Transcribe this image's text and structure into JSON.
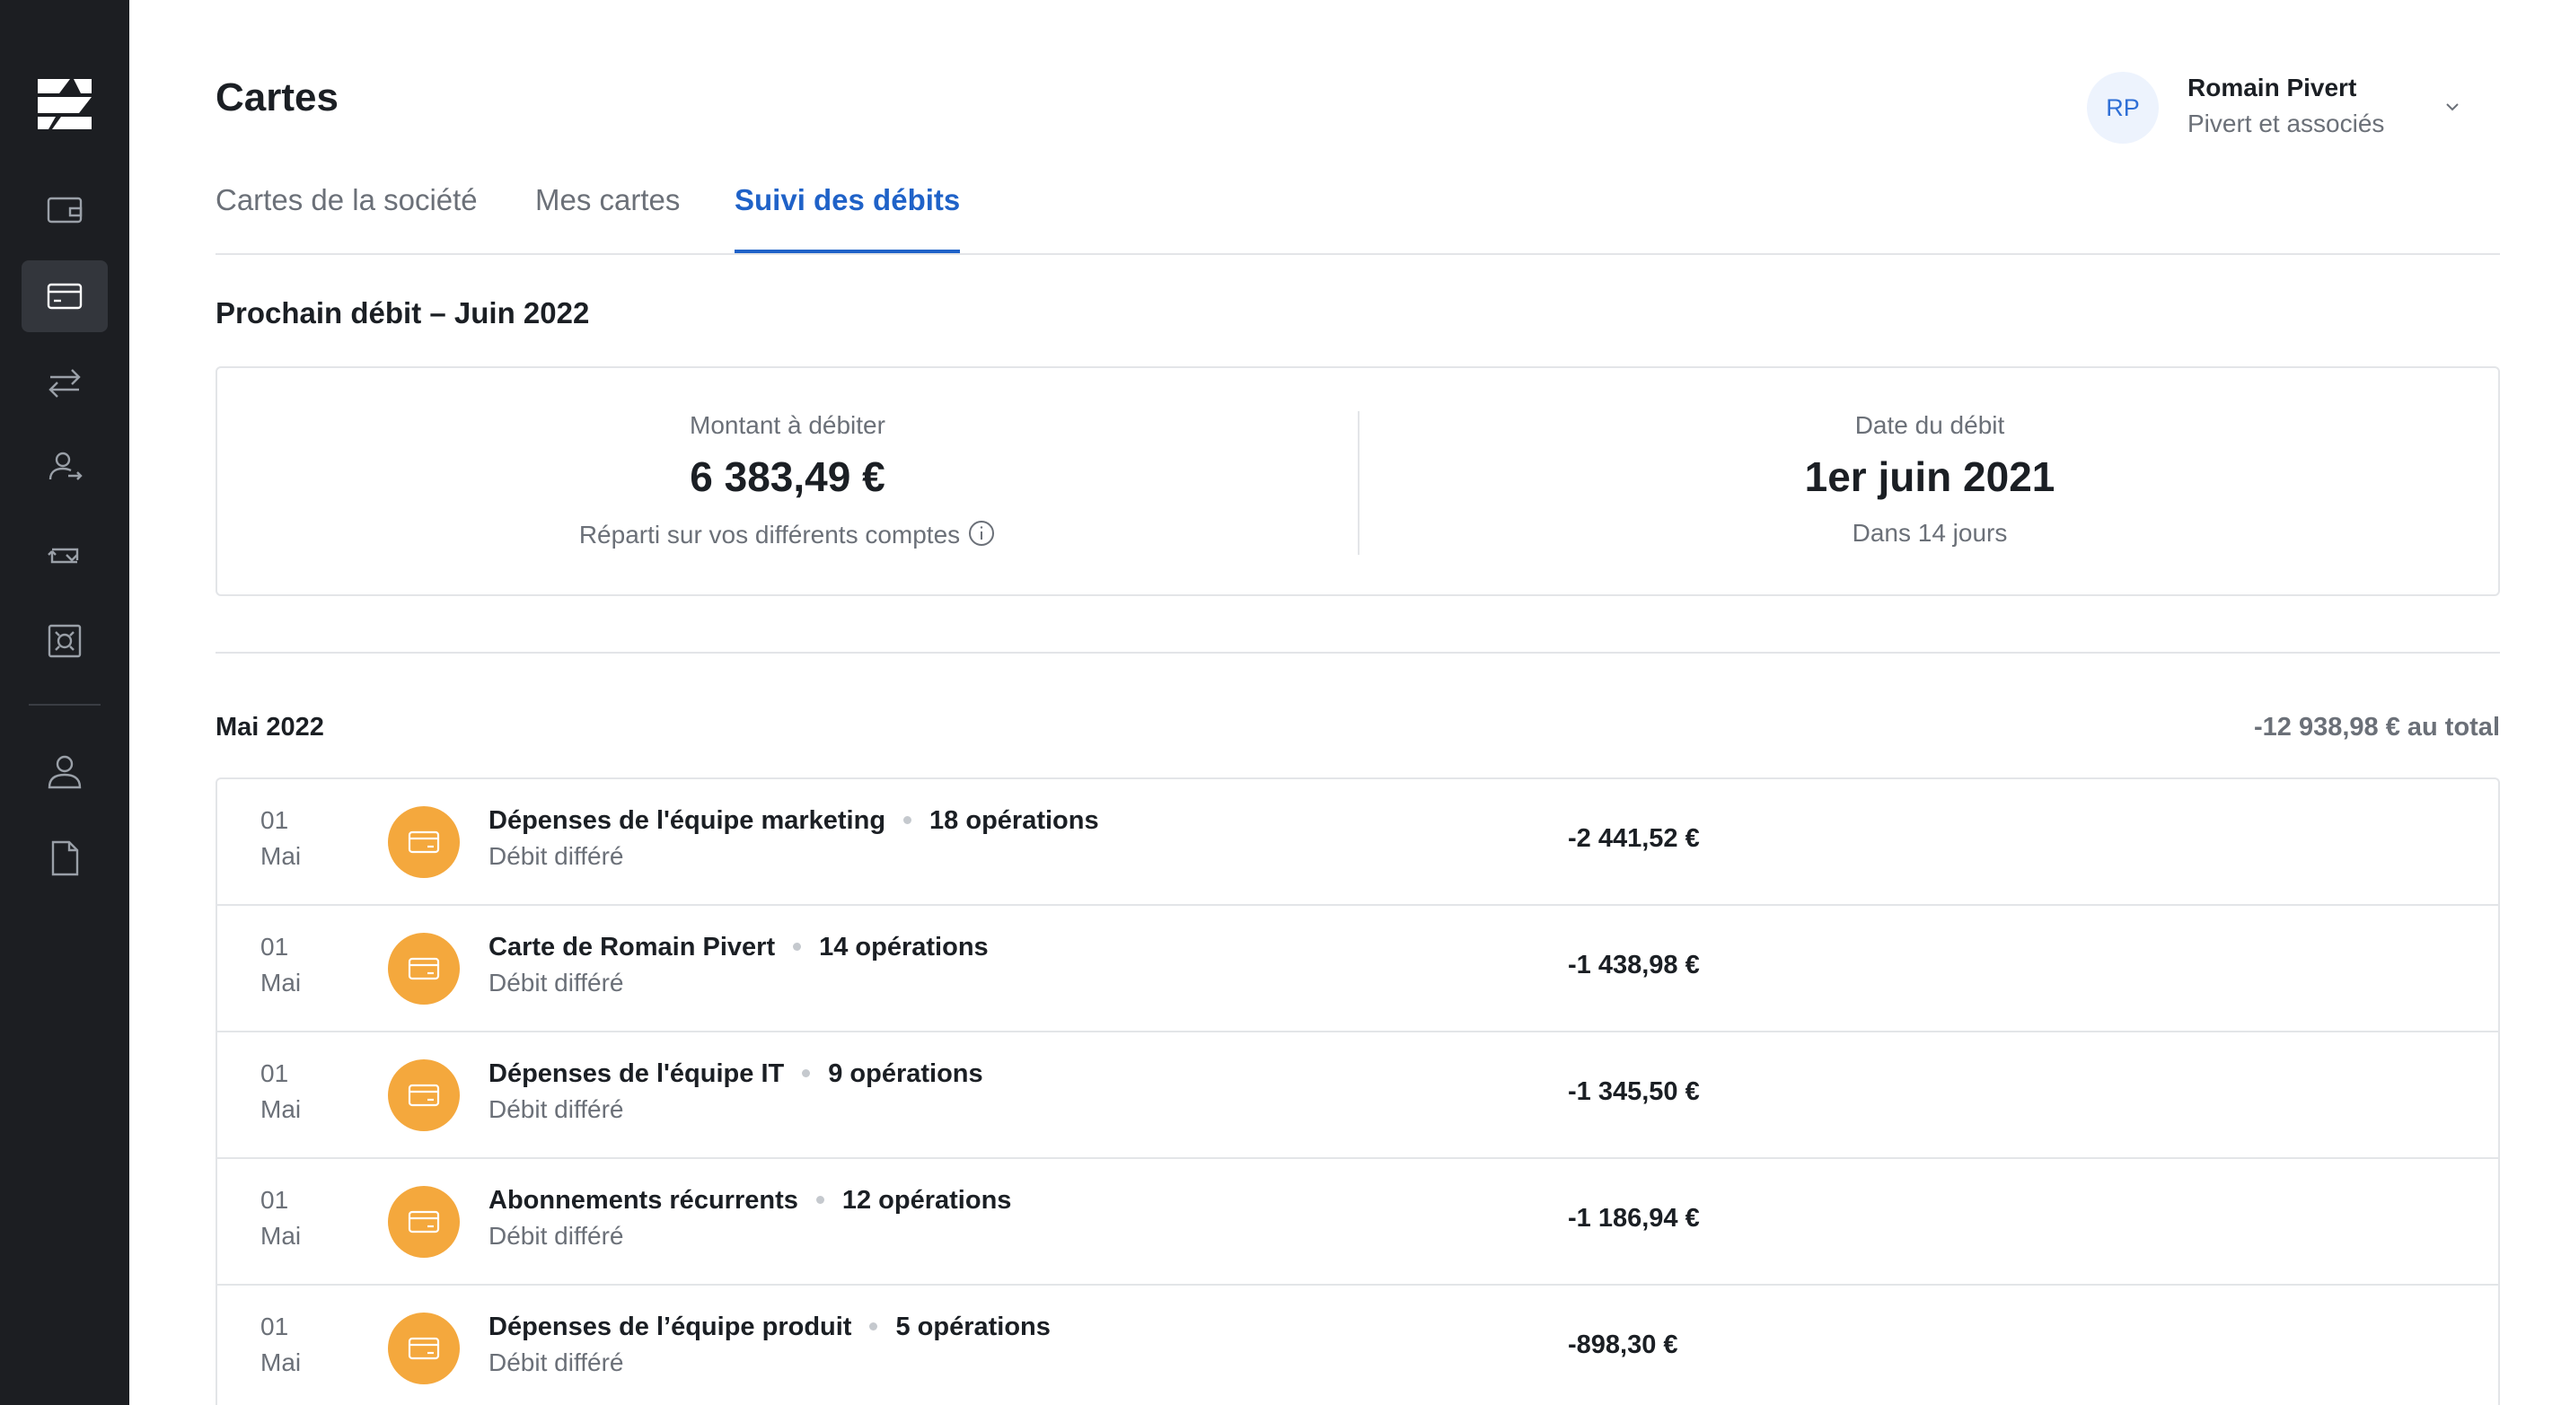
{
  "app": {
    "accent_color": "#1f62c8",
    "sidebar_color": "#1c1e22",
    "card_icon_color": "#f4a83d"
  },
  "sidebar": {
    "items": [
      {
        "icon": "wallet-icon",
        "active": false
      },
      {
        "icon": "card-icon",
        "active": true
      },
      {
        "icon": "transfer-icon",
        "active": false
      },
      {
        "icon": "beneficiaries-icon",
        "active": false
      },
      {
        "icon": "exchange-icon",
        "active": false
      },
      {
        "icon": "safe-icon",
        "active": false
      },
      {
        "icon": "user-icon",
        "active": false
      },
      {
        "icon": "document-icon",
        "active": false
      }
    ]
  },
  "header": {
    "title": "Cartes",
    "user": {
      "initials": "RP",
      "name": "Romain Pivert",
      "company": "Pivert et associés"
    }
  },
  "tabs": [
    {
      "label": "Cartes de la société",
      "active": false
    },
    {
      "label": "Mes cartes",
      "active": false
    },
    {
      "label": "Suivi des débits",
      "active": true
    }
  ],
  "next_debit": {
    "title": "Prochain débit – Juin 2022",
    "amount_label": "Montant à débiter",
    "amount": "6 383,49 €",
    "amount_note": "Réparti sur vos différents comptes",
    "date_label": "Date du débit",
    "date": "1er juin 2021",
    "date_note": "Dans 14 jours"
  },
  "month": {
    "title": "Mai 2022",
    "total": "-12 938,98 € au total",
    "rows": [
      {
        "day": "01",
        "month": "Mai",
        "title": "Dépenses de l'équipe marketing",
        "count": "18 opérations",
        "type": "Débit différé",
        "amount": "-2 441,52 €"
      },
      {
        "day": "01",
        "month": "Mai",
        "title": "Carte de Romain Pivert",
        "count": "14 opérations",
        "type": "Débit différé",
        "amount": "-1 438,98 €"
      },
      {
        "day": "01",
        "month": "Mai",
        "title": "Dépenses de l'équipe IT",
        "count": "9 opérations",
        "type": "Débit différé",
        "amount": "-1 345,50 €"
      },
      {
        "day": "01",
        "month": "Mai",
        "title": "Abonnements récurrents",
        "count": "12 opérations",
        "type": "Débit différé",
        "amount": "-1 186,94 €"
      },
      {
        "day": "01",
        "month": "Mai",
        "title": "Dépenses de l’équipe produit",
        "count": "5 opérations",
        "type": "Débit différé",
        "amount": "-898,30 €"
      }
    ]
  }
}
